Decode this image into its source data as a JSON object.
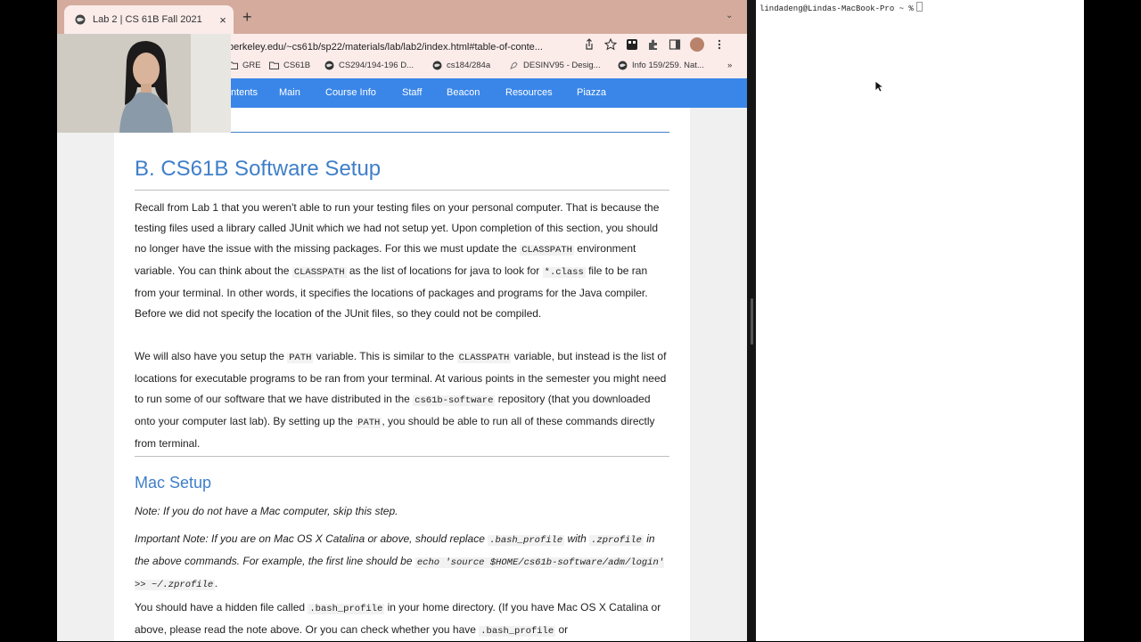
{
  "browser": {
    "tab_title": "Lab 2 | CS 61B Fall 2021",
    "tab_close": "×",
    "new_tab": "+",
    "tab_dropdown": "⌄",
    "url": "berkeley.edu/~cs61b/sp22/materials/lab/lab2/index.html#table-of-conte...",
    "bookmarks": [
      "GRE",
      "CS61B",
      "CS294/194-196 D...",
      "cs184/284a",
      "DESINV95 - Desig...",
      "Info 159/259. Nat..."
    ],
    "bookmarks_more": "»"
  },
  "site_nav": {
    "contents_fragment": "ntents",
    "links": [
      "Main",
      "Course Info",
      "Staff",
      "Beacon",
      "Resources",
      "Piazza"
    ]
  },
  "content": {
    "section_title": "B. CS61B Software Setup",
    "p1": {
      "a": "Recall from Lab 1 that you weren't able to run your testing files on your personal computer. That is because the testing files used a library called JUnit which we had not setup yet. Upon completion of this section, you should no longer have the issue with the missing packages. For this we must update the ",
      "code1": "CLASSPATH",
      "b": " environment variable. You can think about the ",
      "code2": "CLASSPATH",
      "c": " as the list of locations for java to look for ",
      "code3": "*.class",
      "d": " file to be ran from your terminal. In other words, it specifies the locations of packages and programs for the Java compiler. Before we did not specify the location of the JUnit files, so they could not be compiled."
    },
    "p2": {
      "a": "We will also have you setup the ",
      "code1": "PATH",
      "b": " variable. This is similar to the ",
      "code2": "CLASSPATH",
      "c": " variable, but instead is the list of locations for executable programs to be ran from your terminal. At various points in the semester you might need to run some of our software that we have distributed in the ",
      "code3": "cs61b-software",
      "d": " repository (that you downloaded onto your computer last lab). By setting up the ",
      "code4": "PATH",
      "e": ", you should be able to run all of these commands directly from terminal."
    },
    "mac_title": "Mac Setup",
    "note": "Note: If you do not have a Mac computer, skip this step.",
    "important": {
      "a": "Important Note: If you are on Mac OS X Catalina or above, should replace ",
      "code1": ".bash_profile",
      "b": " with ",
      "code2": ".zprofile",
      "c": " in the above commands. For example, the first line should be ",
      "code3": "echo 'source $HOME/cs61b-software/adm/login' >> ~/.zprofile",
      "d": "."
    },
    "p3": {
      "a": "You should have a hidden file called ",
      "code1": ".bash_profile",
      "b": " in your home directory. (If you have Mac OS X Catalina or above, please read the note above. Or you can check whether you have ",
      "code2": ".bash_profile",
      "c": " or"
    }
  },
  "terminal": {
    "prompt": "lindadeng@Lindas-MacBook-Pro ~ %"
  },
  "colors": {
    "nav_bar": "#3a86e8",
    "heading": "#3f7fc9",
    "tab_strip": "#d4ab9c"
  }
}
